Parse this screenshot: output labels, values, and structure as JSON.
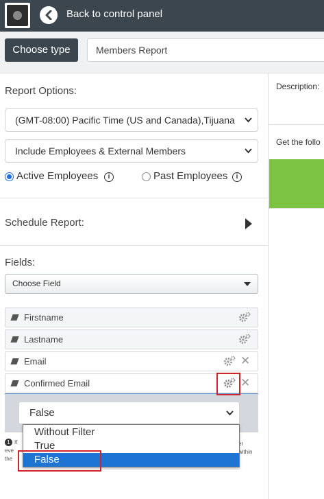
{
  "header": {
    "back_label": "Back to control panel"
  },
  "typebar": {
    "choose_type_label": "Choose type",
    "report_name": "Members Report"
  },
  "report_options": {
    "label": "Report Options:",
    "timezone_value": "(GMT-08:00) Pacific Time (US and Canada),Tijuana",
    "members_value": "Include Employees & External Members",
    "radio_active_label": "Active Employees",
    "radio_past_label": "Past Employees",
    "selected_radio": "Active Employees"
  },
  "schedule": {
    "label": "Schedule Report:"
  },
  "fields": {
    "label": "Fields:",
    "choose_field_placeholder": "Choose Field",
    "items": [
      {
        "label": "Firstname"
      },
      {
        "label": "Lastname"
      },
      {
        "label": "Email"
      },
      {
        "label": "Confirmed Email"
      }
    ]
  },
  "filter": {
    "selected_value": "False",
    "options": [
      "Without Filter",
      "True",
      "False"
    ],
    "highlighted_option": "False"
  },
  "note": {
    "number": "1",
    "text_line1": "If",
    "text_line2": "eve",
    "text_line3": "the",
    "text_right1": "er",
    "text_right2": "within"
  },
  "right_panel": {
    "description_label": "Description:",
    "follow_text": "Get the follo"
  },
  "colors": {
    "topbar": "#3c464e",
    "accent_green": "#7cc343",
    "selection_blue": "#1e74d3",
    "highlight_red": "#d1232a"
  },
  "icons": [
    "back-arrow-icon",
    "chevron-down-icon",
    "info-icon",
    "play-icon",
    "pencil-icon",
    "gear-icon",
    "close-icon",
    "caret-down-icon"
  ]
}
